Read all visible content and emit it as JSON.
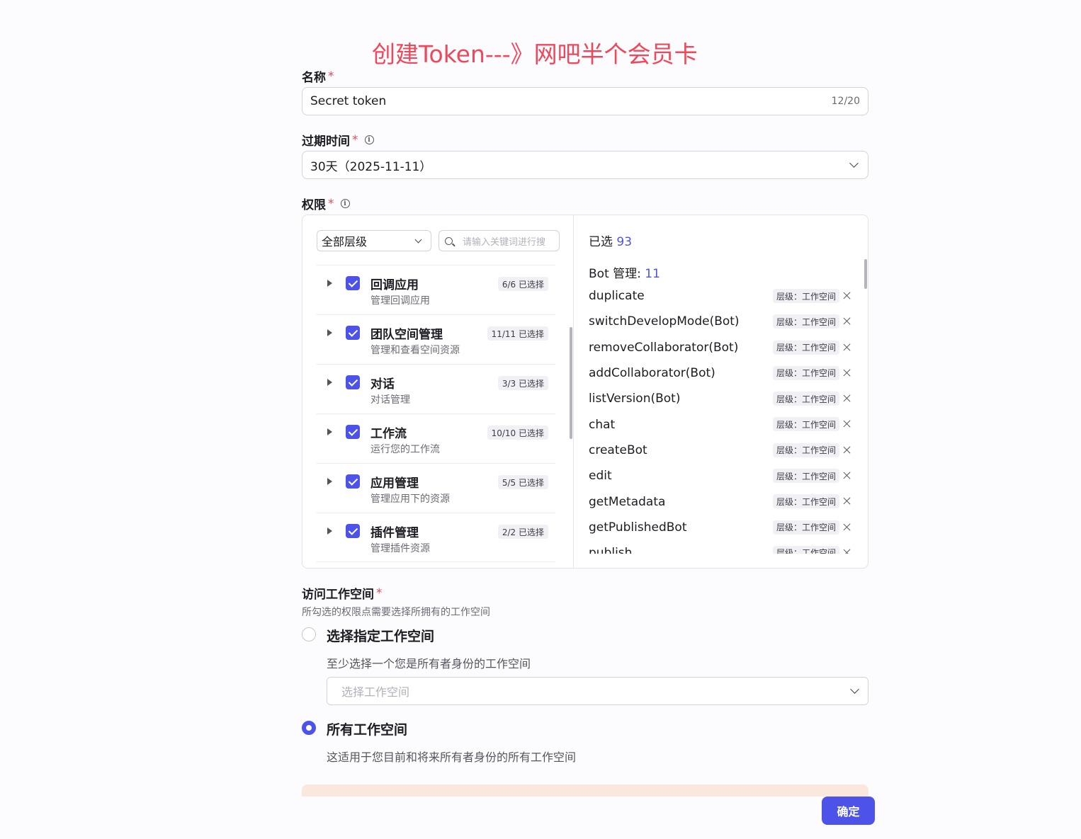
{
  "banner": "创建Token---》网吧半个会员卡",
  "name_field": {
    "label": "名称",
    "required_mark": "*",
    "value": "Secret token",
    "counter": "12/20"
  },
  "expiry_field": {
    "label": "过期时间",
    "required_mark": "*",
    "info_icon": "info-icon",
    "value": "30天（2025-11-11）"
  },
  "permission": {
    "label": "权限",
    "required_mark": "*",
    "info_icon": "info-icon",
    "level_select": "全部层级",
    "search_placeholder": "请输入关键词进行搜",
    "groups": [
      {
        "title": "回调应用",
        "desc": "管理回调应用",
        "badge": "6/6 已选择"
      },
      {
        "title": "团队空间管理",
        "desc": "管理和查看空间资源",
        "badge": "11/11 已选择"
      },
      {
        "title": "对话",
        "desc": "对话管理",
        "badge": "3/3 已选择"
      },
      {
        "title": "工作流",
        "desc": "运行您的工作流",
        "badge": "10/10 已选择"
      },
      {
        "title": "应用管理",
        "desc": "管理应用下的资源",
        "badge": "5/5 已选择"
      },
      {
        "title": "插件管理",
        "desc": "管理插件资源",
        "badge": "2/2 已选择"
      }
    ],
    "selected_label": "已选",
    "selected_count": "93",
    "bot_group_label": "Bot 管理:",
    "bot_group_count": "11",
    "selected_items": [
      {
        "name": "duplicate",
        "tag": "层级：工作空间"
      },
      {
        "name": "switchDevelopMode(Bot)",
        "tag": "层级：工作空间"
      },
      {
        "name": "removeCollaborator(Bot)",
        "tag": "层级：工作空间"
      },
      {
        "name": "addCollaborator(Bot)",
        "tag": "层级：工作空间"
      },
      {
        "name": "listVersion(Bot)",
        "tag": "层级：工作空间"
      },
      {
        "name": "chat",
        "tag": "层级：工作空间"
      },
      {
        "name": "createBot",
        "tag": "层级：工作空间"
      },
      {
        "name": "edit",
        "tag": "层级：工作空间"
      },
      {
        "name": "getMetadata",
        "tag": "层级：工作空间"
      },
      {
        "name": "getPublishedBot",
        "tag": "层级：工作空间"
      },
      {
        "name": "publish",
        "tag": "层级：工作空间"
      }
    ]
  },
  "workspace": {
    "label": "访问工作空间",
    "required_mark": "*",
    "hint": "所勾选的权限点需要选择所拥有的工作空间",
    "option_specific": {
      "title": "选择指定工作空间",
      "desc": "至少选择一个您是所有者身份的工作空间",
      "select_placeholder": "选择工作空间",
      "checked": false
    },
    "option_all": {
      "title": "所有工作空间",
      "desc": "这适用于您目前和将来所有者身份的所有工作空间",
      "checked": true
    }
  },
  "confirm_button": "确定",
  "colors": {
    "accent": "#4d53e8",
    "required": "#f0475a",
    "banner": "#f0475a",
    "warning_strip": "#fbe8dc"
  }
}
